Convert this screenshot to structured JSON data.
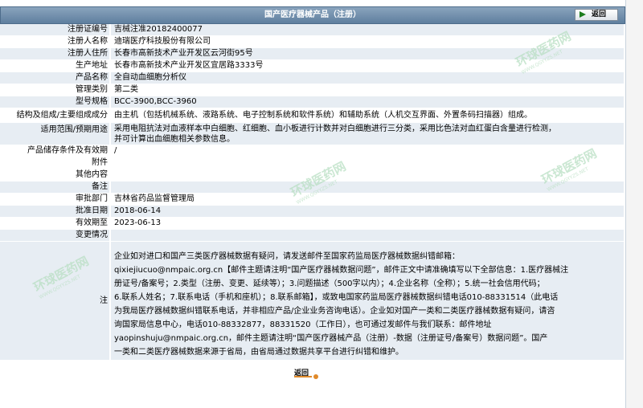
{
  "header": {
    "title": "国产医疗器械产品（注册）",
    "back_label": "返回"
  },
  "fields": [
    {
      "label": "注册证编号",
      "value": "吉械注准20182400077"
    },
    {
      "label": "注册人名称",
      "value": "迪瑞医疗科技股份有限公司"
    },
    {
      "label": "注册人住所",
      "value": "长春市高新技术产业开发区云河街95号"
    },
    {
      "label": "生产地址",
      "value": "长春市高新技术产业开发区宜居路3333号"
    },
    {
      "label": "产品名称",
      "value": "全自动血细胞分析仪"
    },
    {
      "label": "管理类别",
      "value": "第二类"
    },
    {
      "label": "型号规格",
      "value": "BCC-3900,BCC-3960"
    },
    {
      "label": "结构及组成/主要组成成分",
      "value": "由主机（包括机械系统、液路系统、电子控制系统和软件系统）和辅助系统（人机交互界面、外置条码扫描器）组成。"
    },
    {
      "label": "适用范围/预期用途",
      "value_lines": [
        "采用电阻抗法对血液样本中白细胞、红细胞、血小板进行计数并对白细胞进行三分类，采用比色法对血红蛋白含量进行检测，",
        "并可计算出血细胞相关参数信息。"
      ]
    },
    {
      "label": "产品储存条件及有效期",
      "value": "/"
    },
    {
      "label": "附件",
      "value": ""
    },
    {
      "label": "其他内容",
      "value": ""
    },
    {
      "label": "备注",
      "value": ""
    },
    {
      "label": "审批部门",
      "value": "吉林省药品监督管理局"
    },
    {
      "label": "批准日期",
      "value": "2018-06-14"
    },
    {
      "label": "有效期至",
      "value": "2023-06-13"
    },
    {
      "label": "变更情况",
      "value": ""
    }
  ],
  "note": {
    "label": "注",
    "lines": [
      "企业如对进口和国产三类医疗器械数据有疑问，请发送邮件至国家药监局医疗器械数据纠错邮箱：",
      "qixiejiucuo@nmpaic.org.cn【邮件主题请注明“国产医疗器械数据问题”，邮件正文中请准确填写以下全部信息：1.医疗器械注",
      "册证号/备案号；2.类型（注册、变更、延续等）；3.问题描述（500字以内）；4.企业名称（全称）；5.统一社会信用代码；",
      "6.联系人姓名；7.联系电话（手机和座机）；8.联系邮箱】，或致电国家药监局医疗器械数据纠错电话010-88331514（此电话",
      "为我局医疗器械数据纠错联系电话，并非相应产品/企业业务咨询电话）。企业如对国产一类和二类医疗器械数据有疑问，请咨",
      "询国家局信息中心，电话010-88332877，88331520（工作日），也可通过发邮件与我们联系：邮件地址",
      "yaopinshuju@nmpaic.org.cn，邮件主题请注明“国产医疗器械产品（注册）-数据（注册证号/备案号）数据问题”。国产",
      "一类和二类医疗器械数据来源于省局，由省局通过数据共享平台进行纠错和维护。"
    ]
  },
  "footer": {
    "back_label": "返回"
  },
  "watermark": {
    "text": "环球医药网",
    "sub": "WWW.QGYYZS.NET"
  }
}
